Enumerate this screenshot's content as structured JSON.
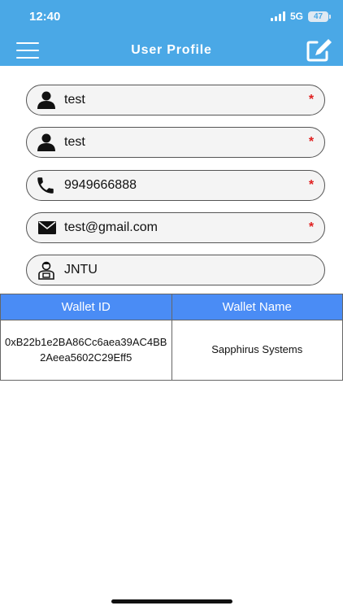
{
  "status_bar": {
    "time": "12:40",
    "network": "5G",
    "battery": "47"
  },
  "app_bar": {
    "title": "User Profile"
  },
  "profile": {
    "fields": [
      {
        "value": "test",
        "required": "*"
      },
      {
        "value": "test",
        "required": "*"
      },
      {
        "value": "9949666888",
        "required": "*"
      },
      {
        "value": "test@gmail.com",
        "required": "*"
      },
      {
        "value": "JNTU"
      }
    ]
  },
  "wallet_table": {
    "headers": [
      "Wallet ID",
      "Wallet Name"
    ],
    "rows": [
      {
        "id": "0xB22b1e2BA86Cc6aea39AC4BB2Aeea5602C29Eff5",
        "name": "Sapphirus Systems"
      }
    ]
  },
  "colors": {
    "header": "#4aa8e6",
    "table_header": "#4a8cf5",
    "required": "#e02020"
  }
}
